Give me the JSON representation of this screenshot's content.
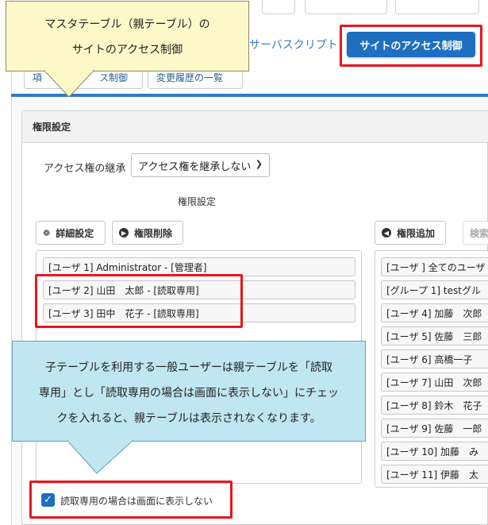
{
  "tabs": {
    "top_tabs": [
      "",
      "",
      ""
    ],
    "script_tab": "サーバスクリプト",
    "site_access_tab": "サイトのアクセス制御",
    "sub_buttons": [
      "項",
      "ス制御",
      "変更履歴の一覧"
    ]
  },
  "callout_top": {
    "line1": "マスタテーブル（親テーブル）の",
    "line2": "サイトのアクセス制御"
  },
  "panel": {
    "title": "権限設定",
    "inherit_label": "アクセス権の継承",
    "inherit_value": "アクセス権を継承しない",
    "section_label": "権限設定",
    "detail_button": "詳細設定",
    "delete_button": "権限削除",
    "add_button": "権限追加",
    "search_button": "検索",
    "assigned": [
      "[ユーザ 1] Administrator - [管理者]",
      "[ユーザ 2] 山田　太郎 - [読取専用]",
      "[ユーザ 3] 田中　花子 - [読取専用]"
    ],
    "available": [
      "[ユーザ ] 全てのユーザ",
      "[グループ 1] testグル",
      "[ユーザ 4] 加藤　次郎",
      "[ユーザ 5] 佐藤　三郎",
      "[ユーザ 6] 高橋一子",
      "[ユーザ 7] 山田　次郎",
      "[ユーザ 8] 鈴木　花子",
      "[ユーザ 9] 佐藤　一郎",
      "[ユーザ 10] 加藤　み",
      "[ユーザ 11] 伊藤　太"
    ],
    "hide_readonly_label": "読取専用の場合は画面に表示しない"
  },
  "callout_bottom": {
    "line1": "子テーブルを利用する一般ユーザーは親テーブルを「読取",
    "line2": "専用」とし「読取専用の場合は画面に表示しない」にチェッ",
    "line3": "クを入れると、親テーブルは表示されなくなります。"
  },
  "colors": {
    "accent": "#1e6fbf",
    "highlight": "#e8161e",
    "callout_yellow": "#fcf8c8",
    "callout_blue": "#bfe6f1"
  }
}
